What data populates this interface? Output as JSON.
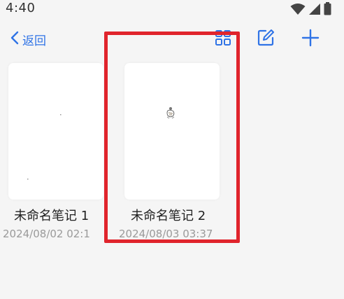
{
  "status_bar": {
    "time": "4:40",
    "icons": [
      "wifi-icon",
      "cellular-signal-icon",
      "battery-icon"
    ]
  },
  "toolbar": {
    "back_label": "返回",
    "icons": [
      "grid-view-icon",
      "edit-icon",
      "add-icon"
    ]
  },
  "notes": [
    {
      "title": "未命名笔记 1",
      "date": "2024/08/02 02:1"
    },
    {
      "title": "未命名笔记 2",
      "date": "2024/08/03 03:37"
    }
  ],
  "colors": {
    "accent": "#2f73e6",
    "highlight": "#e0242c",
    "background": "#f5f5f5",
    "date_text": "#9a9a9a"
  }
}
